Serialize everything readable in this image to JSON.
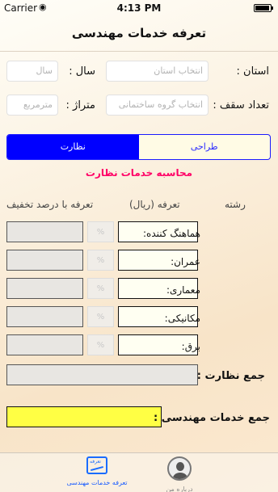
{
  "status_bar": {
    "carrier": "Carrier",
    "wifi_icon": "wifi-icon",
    "time": "4:13 PM",
    "battery_icon": "battery-icon"
  },
  "navbar": {
    "title": "تعرفه خدمات مهندسی"
  },
  "form": {
    "province_label": "استان :",
    "province_placeholder": "انتخاب استان",
    "year_label": "سال :",
    "year_placeholder": "سال",
    "floors_label": "تعداد سقف :",
    "floors_placeholder": "انتخاب گروه ساختمانی",
    "area_label": "متراژ :",
    "area_placeholder": "مترمربع"
  },
  "segment": {
    "design_label": "طراحی",
    "supervision_label": "نظارت",
    "selected": "نظارت"
  },
  "section_title": "محاسبه خدمات نظارت",
  "columns": {
    "field": "رشته",
    "tariff": "تعرفه (ریال)",
    "discount": "تعرفه با درصد تخفیف"
  },
  "rows": [
    {
      "label": "هماهنگ کننده:",
      "percent": "%"
    },
    {
      "label": "عمران:",
      "percent": "%"
    },
    {
      "label": "معماری:",
      "percent": "%"
    },
    {
      "label": "مکانیکی:",
      "percent": "%"
    },
    {
      "label": "برق:",
      "percent": "%"
    }
  ],
  "supervision_total_label": "جمع نظارت :",
  "engineering_total_label": "جمع خدمات مهندسی :",
  "accent_colors": {
    "segment_active": "#0000ff",
    "section_title": "#ff0066",
    "total_field": "#ffff44"
  },
  "tabbar": {
    "tabs": [
      {
        "label": "تعرفه خدمات مهندسی",
        "icon": "tariff-icon",
        "icon_text": "تعرفه",
        "active": true
      },
      {
        "label": "درباره من",
        "icon": "avatar-icon",
        "active": false
      }
    ]
  }
}
